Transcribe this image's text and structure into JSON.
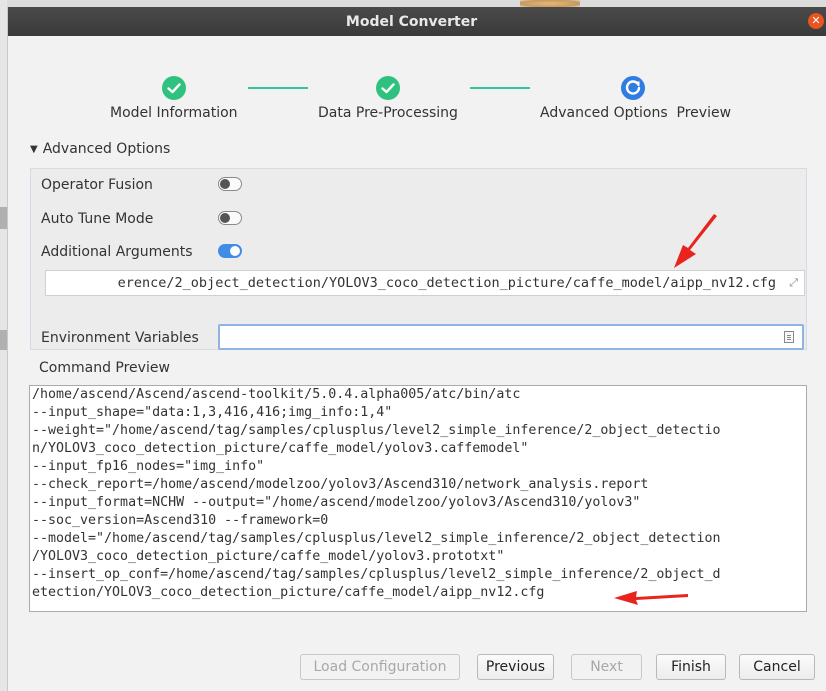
{
  "window": {
    "title": "Model Converter"
  },
  "steps": [
    {
      "label": "Model Information",
      "status": "done"
    },
    {
      "label": "Data Pre-Processing",
      "status": "done"
    },
    {
      "label": "Advanced Options  Preview",
      "status": "current"
    }
  ],
  "advanced": {
    "section_title": "Advanced Options",
    "operator_fusion_label": "Operator Fusion",
    "operator_fusion_on": false,
    "auto_tune_label": "Auto Tune Mode",
    "auto_tune_on": false,
    "additional_args_label": "Additional Arguments",
    "additional_args_on": true,
    "additional_args_value": "erence/2_object_detection/YOLOV3_coco_detection_picture/caffe_model/aipp_nv12.cfg",
    "env_vars_label": "Environment Variables",
    "env_vars_value": ""
  },
  "command_preview": {
    "label": "Command Preview",
    "lines": [
      "/home/ascend/Ascend/ascend-toolkit/5.0.4.alpha005/atc/bin/atc",
      "--input_shape=\"data:1,3,416,416;img_info:1,4\"",
      "--weight=\"/home/ascend/tag/samples/cplusplus/level2_simple_inference/2_object_detectio",
      "n/YOLOV3_coco_detection_picture/caffe_model/yolov3.caffemodel\"",
      "--input_fp16_nodes=\"img_info\"",
      "--check_report=/home/ascend/modelzoo/yolov3/Ascend310/network_analysis.report",
      "--input_format=NCHW --output=\"/home/ascend/modelzoo/yolov3/Ascend310/yolov3\"",
      "--soc_version=Ascend310 --framework=0",
      "--model=\"/home/ascend/tag/samples/cplusplus/level2_simple_inference/2_object_detection",
      "/YOLOV3_coco_detection_picture/caffe_model/yolov3.prototxt\"",
      "--insert_op_conf=/home/ascend/tag/samples/cplusplus/level2_simple_inference/2_object_d",
      "etection/YOLOV3_coco_detection_picture/caffe_model/aipp_nv12.cfg"
    ]
  },
  "buttons": {
    "load_configuration": "Load Configuration",
    "previous": "Previous",
    "next": "Next",
    "finish": "Finish",
    "cancel": "Cancel"
  },
  "colors": {
    "title_bar": "#3f3f3f",
    "step_done": "#2ec27e",
    "step_current": "#2f7de1",
    "toggle_on": "#3f8de5",
    "annotation_arrow": "#e8241c"
  }
}
